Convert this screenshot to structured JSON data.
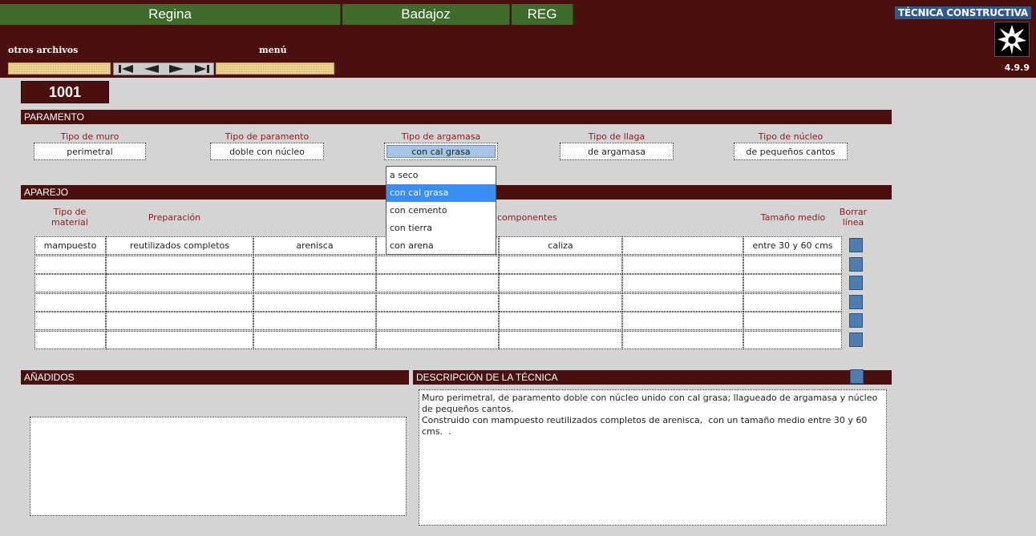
{
  "header": {
    "site": "Regina",
    "province": "Badajoz",
    "code": "REG",
    "otros_archivos": "otros archivos",
    "menu": "menú",
    "module_title": "TÉCNICA CONSTRUCTIVA",
    "version": "4.9.9",
    "nav_icons": [
      "first-record-icon",
      "prev-record-icon",
      "next-record-icon",
      "last-record-icon"
    ]
  },
  "record": {
    "id": "1001"
  },
  "paramento": {
    "title": "PARAMENTO",
    "fields": [
      {
        "label": "Tipo de muro",
        "value": "perimetral"
      },
      {
        "label": "Tipo de paramento",
        "value": "doble con núcleo"
      },
      {
        "label": "Tipo de argamasa",
        "value": "con cal grasa"
      },
      {
        "label": "Tipo de llaga",
        "value": "de argamasa"
      },
      {
        "label": "Tipo de núcleo",
        "value": "de pequeños cantos"
      }
    ],
    "argamasa_options": [
      "a seco",
      "con cal grasa",
      "con cemento",
      "con tierra",
      "con arena"
    ],
    "argamasa_selected": "con cal grasa"
  },
  "aparejo": {
    "title": "APAREJO",
    "columns": {
      "tipo_material": "Tipo de material",
      "preparacion": "Preparación",
      "componentes": "componentes",
      "tamano": "Tamaño medio",
      "borrar": "Borrar línea"
    },
    "rows": [
      [
        "mampuesto",
        "reutilizados completos",
        "arenisca",
        "",
        "caliza",
        "",
        "entre 30 y 60 cms"
      ],
      [
        "",
        "",
        "",
        "",
        "",
        "",
        ""
      ],
      [
        "",
        "",
        "",
        "",
        "",
        "",
        ""
      ],
      [
        "",
        "",
        "",
        "",
        "",
        "",
        ""
      ],
      [
        "",
        "",
        "",
        "",
        "",
        "",
        ""
      ],
      [
        "",
        "",
        "",
        "",
        "",
        "",
        ""
      ]
    ]
  },
  "anadidos": {
    "title": "AÑADIDOS",
    "text": ""
  },
  "descripcion": {
    "title": "DESCRIPCIÓN DE LA TÉCNICA",
    "text": "Muro perimetral, de paramento doble con núcleo unido con cal grasa; llagueado de argamasa y núcleo de pequeños cantos.\nConstruido con mampuesto reutilizados completos de arenisca,  con un tamaño medio entre 30 y 60 cms.  ."
  },
  "colors": {
    "header_bg": "#4a0f0f",
    "green_bar": "#3e6a2a",
    "label_red": "#8a1c1c",
    "selection_blue": "#3a8df2",
    "button_blue": "#4e7db0"
  }
}
